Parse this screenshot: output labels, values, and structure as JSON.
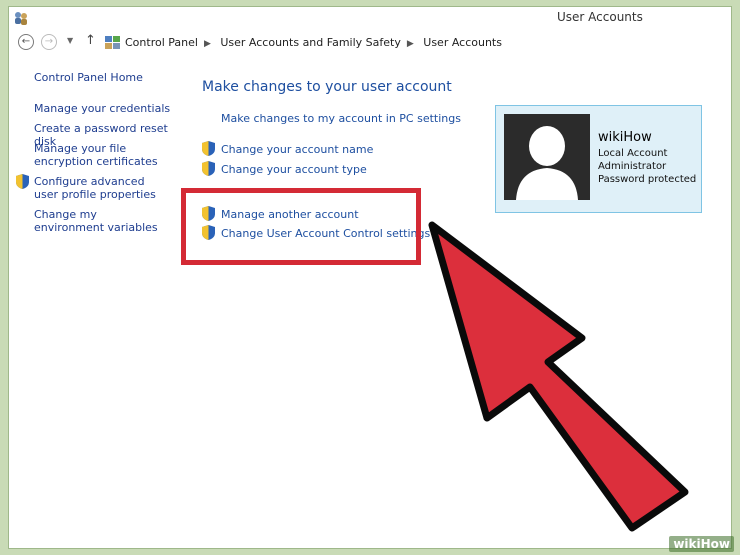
{
  "window": {
    "title": "User Accounts"
  },
  "address": {
    "crumbs": [
      "Control Panel",
      "User Accounts and Family Safety",
      "User Accounts"
    ]
  },
  "sidebar": {
    "items": [
      {
        "label": "Control Panel Home"
      },
      {
        "label": "Manage your credentials"
      },
      {
        "label": "Create a password reset disk"
      },
      {
        "label": "Manage your file encryption certificates"
      },
      {
        "label": "Configure advanced user profile properties"
      },
      {
        "label": "Change my environment variables"
      }
    ]
  },
  "main": {
    "title": "Make changes to your user account",
    "pc_settings_link": "Make changes to my account in PC settings",
    "links": [
      {
        "label": "Change your account name"
      },
      {
        "label": "Change your account type"
      },
      {
        "label": "Manage another account"
      },
      {
        "label": "Change User Account Control settings"
      }
    ]
  },
  "account": {
    "name": "wikiHow",
    "lines": [
      "Local Account",
      "Administrator",
      "Password protected"
    ]
  },
  "watermark": {
    "brand": "wikiHow"
  },
  "colors": {
    "link": "#1e4fa0",
    "highlight": "#d42a35",
    "arrow": "#dc2f3c"
  }
}
